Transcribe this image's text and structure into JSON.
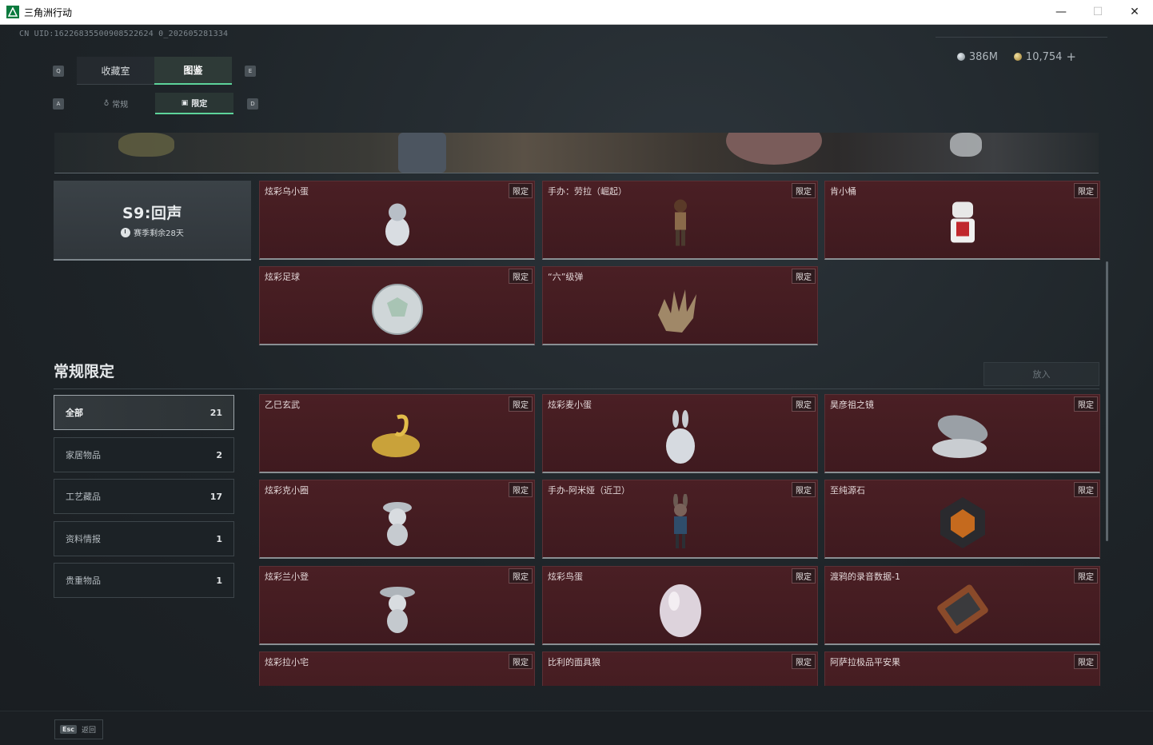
{
  "window": {
    "title": "三角洲行动",
    "minimize": "—",
    "maximize": "☐",
    "close": "✕"
  },
  "uid": "CN UID:16226835500908522624 0_202605281334",
  "currency": {
    "silver": "386M",
    "gold": "10,754",
    "plus": "+"
  },
  "keys": {
    "q": "Q",
    "e": "E",
    "a": "A",
    "d": "D"
  },
  "tabs": {
    "collection_room": "收藏室",
    "catalog": "图鉴",
    "regular": "常规",
    "limited": "限定"
  },
  "season": {
    "title": "S9:回声",
    "remaining": "赛季剩余28天"
  },
  "season_items": [
    {
      "name": "炫彩乌小蛋",
      "tag": "限定"
    },
    {
      "name": "手办：劳拉（崛起）",
      "tag": "限定"
    },
    {
      "name": "肯小桶",
      "tag": "限定"
    },
    {
      "name": "炫彩足球",
      "tag": "限定"
    },
    {
      "name": "“六”级弹",
      "tag": "限定"
    }
  ],
  "section": {
    "title": "常规限定",
    "put_button": "放入"
  },
  "categories": [
    {
      "label": "全部",
      "count": "21"
    },
    {
      "label": "家居物品",
      "count": "2"
    },
    {
      "label": "工艺藏品",
      "count": "17"
    },
    {
      "label": "资料情报",
      "count": "1"
    },
    {
      "label": "贵重物品",
      "count": "1"
    }
  ],
  "items": [
    {
      "name": "乙巳玄武",
      "tag": "限定"
    },
    {
      "name": "炫彩麦小蛋",
      "tag": "限定"
    },
    {
      "name": "昊彦祖之镜",
      "tag": "限定"
    },
    {
      "name": "炫彩克小圈",
      "tag": "限定"
    },
    {
      "name": "手办-阿米娅（近卫）",
      "tag": "限定"
    },
    {
      "name": "至纯源石",
      "tag": "限定"
    },
    {
      "name": "炫彩兰小登",
      "tag": "限定"
    },
    {
      "name": "炫彩鸟蛋",
      "tag": "限定"
    },
    {
      "name": "渡鸦的录音数据-1",
      "tag": "限定"
    },
    {
      "name": "炫彩拉小宅",
      "tag": "限定"
    },
    {
      "name": "比利的面具狼",
      "tag": "限定"
    },
    {
      "name": "阿萨拉极品平安果",
      "tag": "限定"
    }
  ],
  "footer": {
    "esc_key": "Esc",
    "back": "返回"
  },
  "colors": {
    "accent": "#5dd39a",
    "card_bg": "#4a1f24"
  }
}
